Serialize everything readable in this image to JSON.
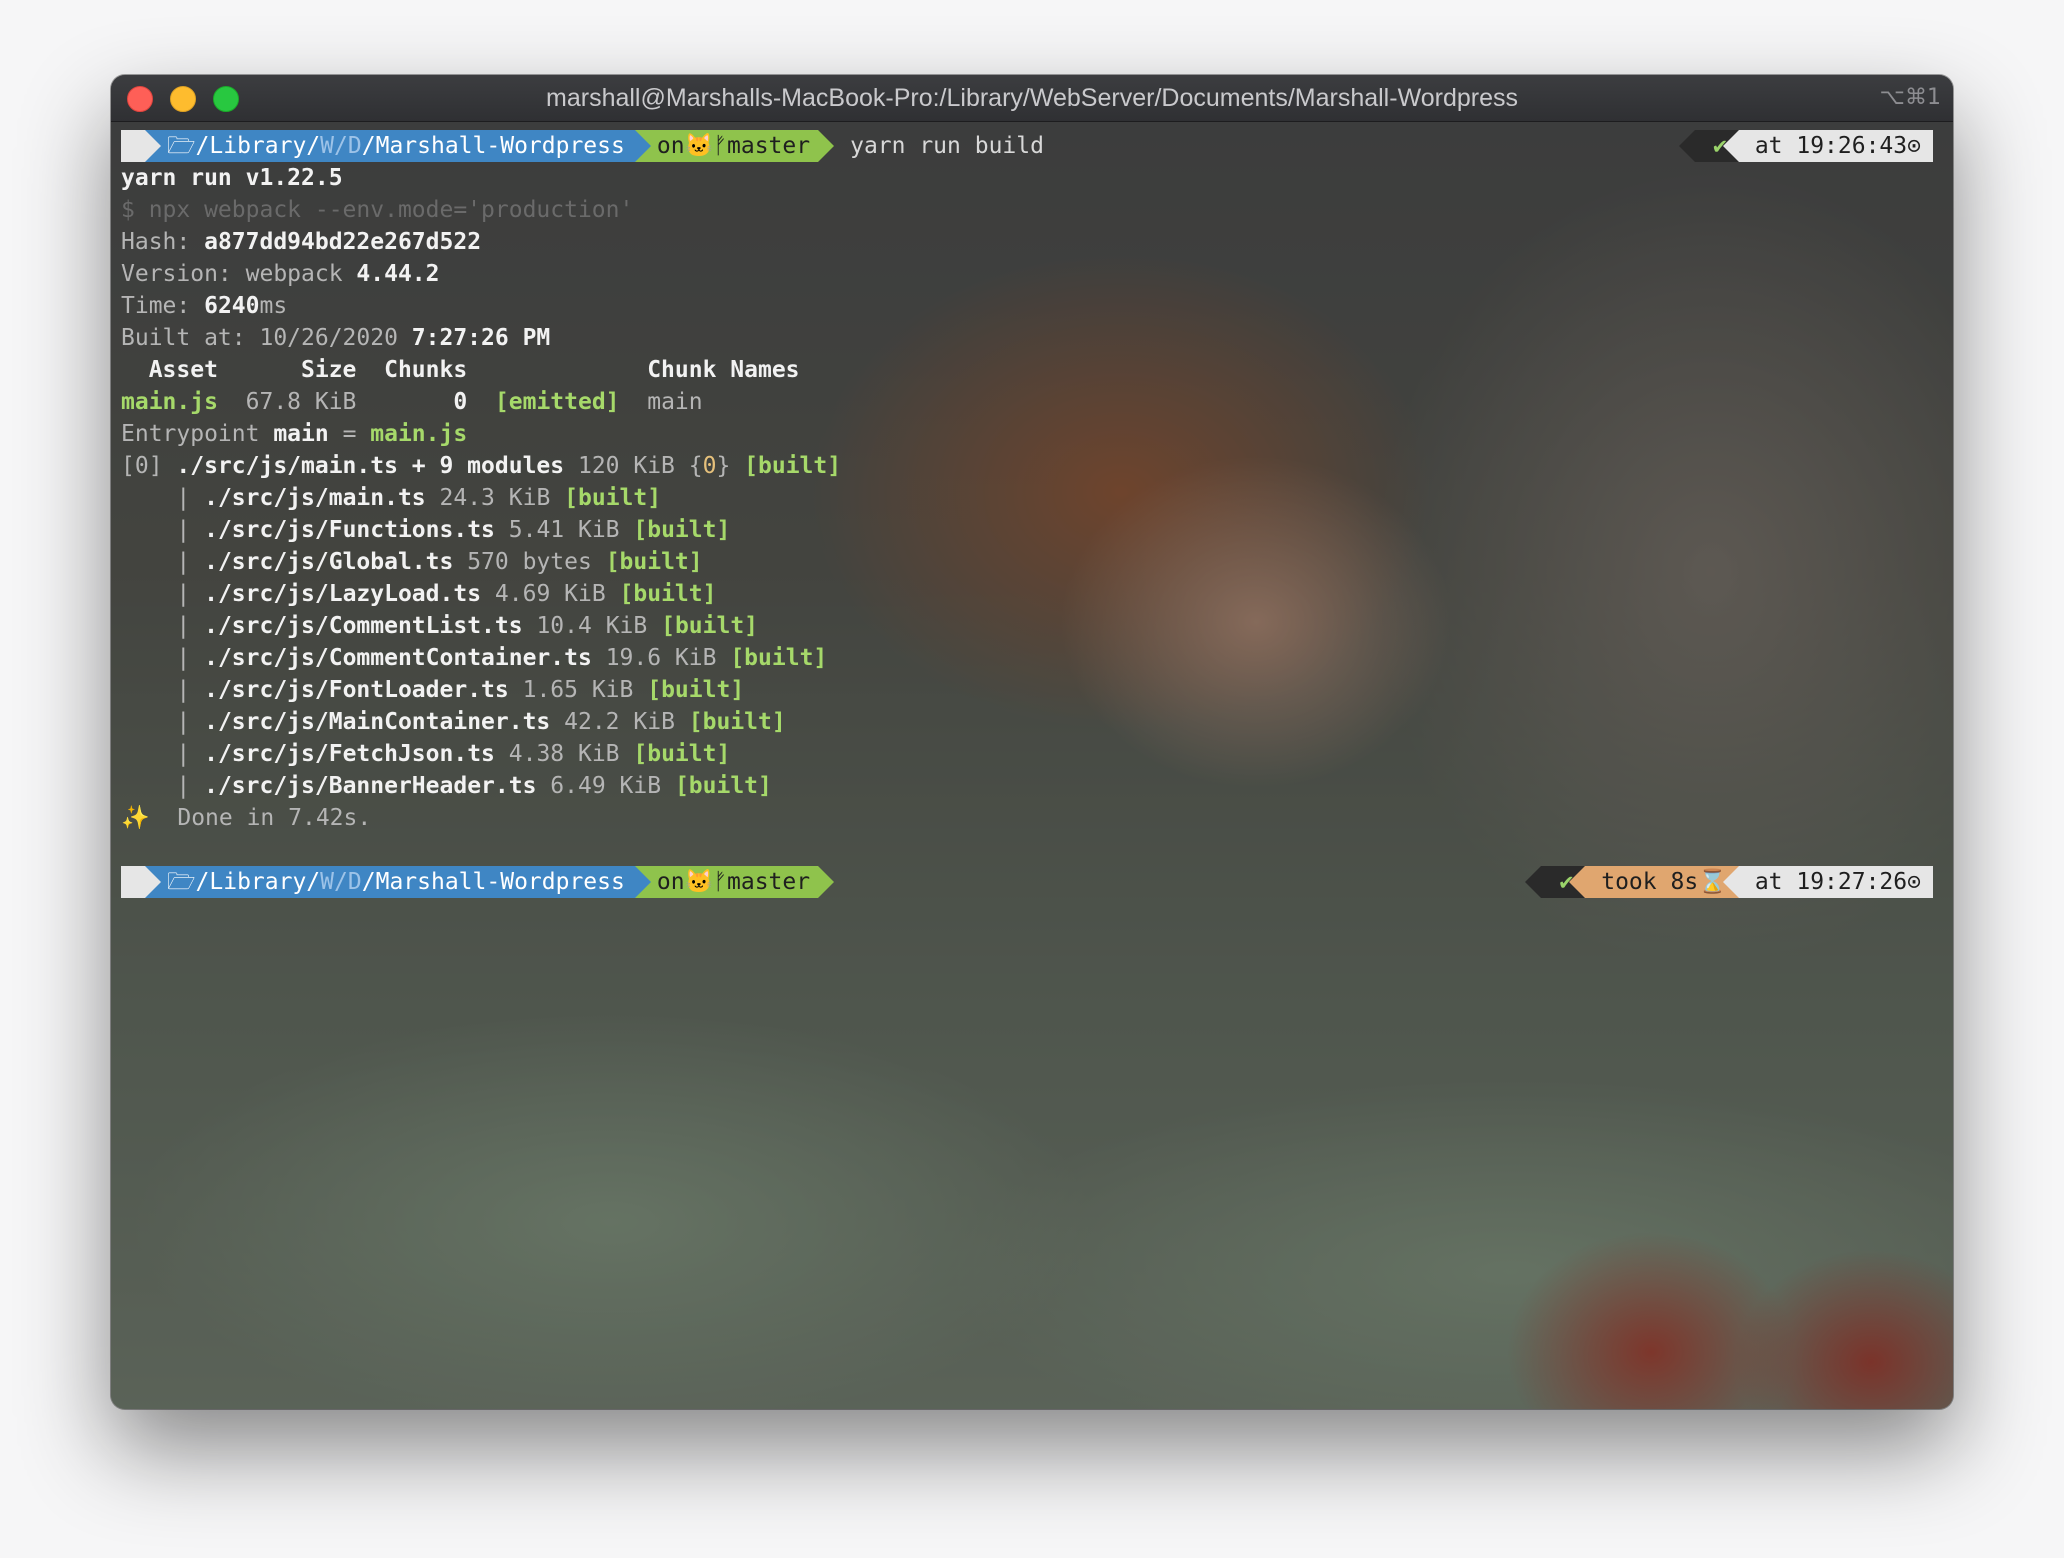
{
  "window": {
    "title": "marshall@Marshalls-MacBook-Pro:/Library/WebServer/Documents/Marshall-Wordpress",
    "shortcut": "⌥⌘1"
  },
  "prompt1": {
    "apple": "",
    "folder_icon": "🗁",
    "path_root": "/Library/",
    "path_w": "W",
    "path_sep1": "/",
    "path_d": "D",
    "path_sep2": "/",
    "path_dir": "Marshall-Wordpress",
    "git_on": "on",
    "git_icon": "🐱",
    "branch_icon": "ᚠ",
    "branch": "master",
    "command": "yarn run build",
    "status": "✔",
    "time": "at 19:26:43",
    "clock_icon": "⊙"
  },
  "output": {
    "yarn": "yarn run v1.22.5",
    "npx": "$ npx webpack --env.mode='production'",
    "hash_label": "Hash: ",
    "hash": "a877dd94bd22e267d522",
    "version_label": "Version: webpack ",
    "version": "4.44.2",
    "time_label": "Time: ",
    "time_value": "6240",
    "time_unit": "ms",
    "built_label": "Built at: 10/26/2020 ",
    "built_time": "7:27:26 PM",
    "table_header": "  Asset      Size  Chunks             Chunk Names",
    "asset_name": "main.js",
    "asset_size": "  67.8 KiB       ",
    "asset_chunk": "0",
    "asset_emitted": "[emitted]",
    "asset_chunkname": "main",
    "entry_label": "Entrypoint ",
    "entry_main": "main",
    "entry_eq": " = ",
    "entry_file": "main.js",
    "module_index": "[0] ",
    "module_path": "./src/js/main.ts + 9 modules",
    "module_size": " 120 KiB {",
    "module_chunk": "0",
    "module_close": "} ",
    "module_status": "[built]",
    "modules": [
      {
        "path": "./src/js/main.ts",
        "size": "24.3 KiB",
        "status": "[built]"
      },
      {
        "path": "./src/js/Functions.ts",
        "size": "5.41 KiB",
        "status": "[built]"
      },
      {
        "path": "./src/js/Global.ts",
        "size": "570 bytes",
        "status": "[built]"
      },
      {
        "path": "./src/js/LazyLoad.ts",
        "size": "4.69 KiB",
        "status": "[built]"
      },
      {
        "path": "./src/js/CommentList.ts",
        "size": "10.4 KiB",
        "status": "[built]"
      },
      {
        "path": "./src/js/CommentContainer.ts",
        "size": "19.6 KiB",
        "status": "[built]"
      },
      {
        "path": "./src/js/FontLoader.ts",
        "size": "1.65 KiB",
        "status": "[built]"
      },
      {
        "path": "./src/js/MainContainer.ts",
        "size": "42.2 KiB",
        "status": "[built]"
      },
      {
        "path": "./src/js/FetchJson.ts",
        "size": "4.38 KiB",
        "status": "[built]"
      },
      {
        "path": "./src/js/BannerHeader.ts",
        "size": "6.49 KiB",
        "status": "[built]"
      }
    ],
    "done_icon": "✨",
    "done": "Done in 7.42s."
  },
  "prompt2": {
    "apple": "",
    "folder_icon": "🗁",
    "path_root": "/Library/",
    "path_w": "W",
    "path_sep1": "/",
    "path_d": "D",
    "path_sep2": "/",
    "path_dir": "Marshall-Wordpress",
    "git_on": "on",
    "git_icon": "🐱",
    "branch_icon": "ᚠ",
    "branch": "master",
    "status": "✔",
    "took": "took 8s",
    "hourglass_icon": "⌛",
    "time": "at 19:27:26",
    "clock_icon": "⊙"
  }
}
